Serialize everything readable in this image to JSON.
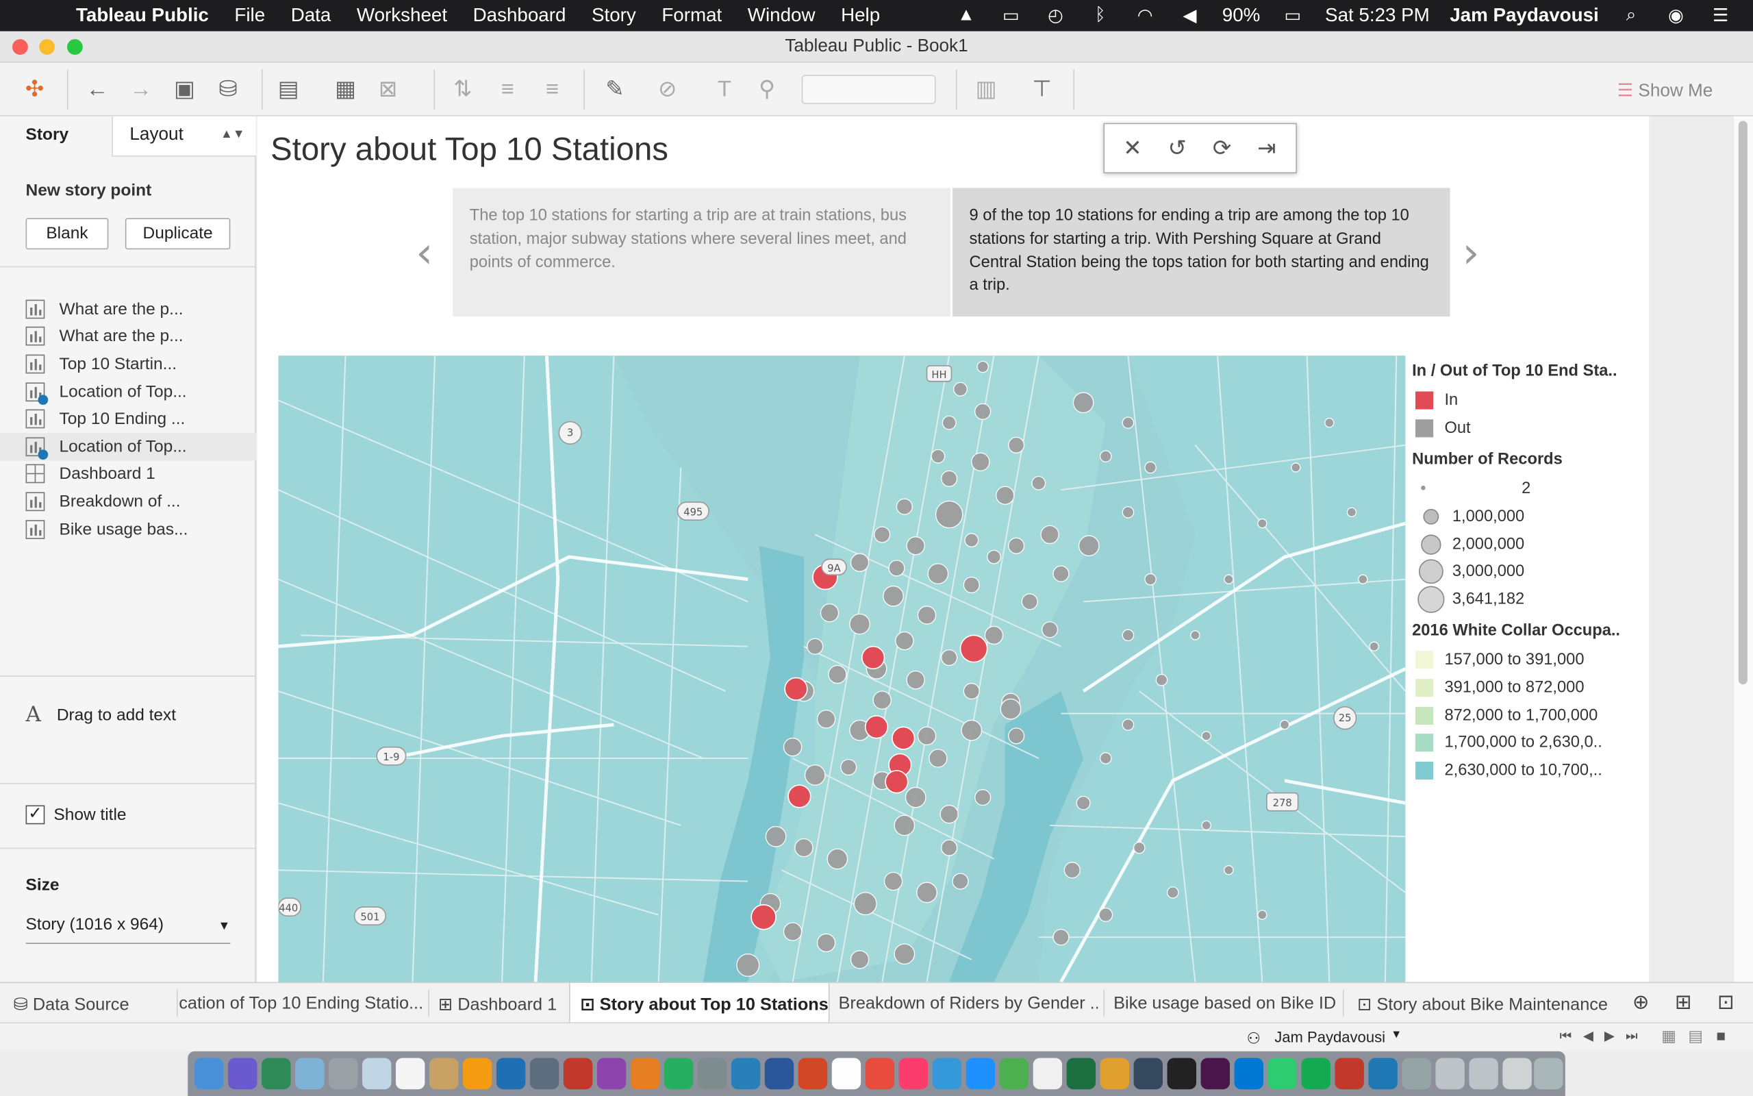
{
  "menubar": {
    "app_name": "Tableau Public",
    "items": [
      "File",
      "Data",
      "Worksheet",
      "Dashboard",
      "Story",
      "Format",
      "Window",
      "Help"
    ],
    "battery": "90%",
    "clock": "Sat 5:23 PM",
    "user": "Jam Paydavousi"
  },
  "window": {
    "title": "Tableau Public - Book1"
  },
  "toolbar": {
    "show_me": "Show Me"
  },
  "left_pane": {
    "tab_story": "Story",
    "tab_layout": "Layout",
    "new_story_point": "New story point",
    "blank_button": "Blank",
    "duplicate_button": "Duplicate",
    "story_items": [
      {
        "label": "What are the p...",
        "icon": "worksheet-icon"
      },
      {
        "label": "What are the p...",
        "icon": "worksheet-icon"
      },
      {
        "label": "Top 10 Startin...",
        "icon": "worksheet-icon"
      },
      {
        "label": "Location of Top...",
        "icon": "worksheet-check-icon"
      },
      {
        "label": "Top 10 Ending ...",
        "icon": "worksheet-icon"
      },
      {
        "label": "Location of Top...",
        "icon": "worksheet-check-icon"
      },
      {
        "label": "Dashboard 1",
        "icon": "dashboard-icon"
      },
      {
        "label": "Breakdown of ...",
        "icon": "worksheet-icon"
      },
      {
        "label": "Bike usage bas...",
        "icon": "worksheet-icon"
      }
    ],
    "drag_text": "Drag to add text",
    "show_title": "Show title",
    "size_heading": "Size",
    "size_value": "Story (1016 x 964)"
  },
  "story": {
    "title": "Story about Top 10 Stations",
    "points": [
      "The top 10 stations for starting a trip are at train stations, bus station, major subway stations where several lines meet, and points of commerce.",
      "9 of the top 10 stations for ending a trip are among the top 10 stations for starting a trip.  With Pershing Square at Grand Central Station being the tops tation for both starting and ending a trip."
    ]
  },
  "map": {
    "road_labels": [
      "3",
      "495",
      "1-9",
      "501",
      "440",
      "25",
      "278",
      "HH",
      "9A"
    ]
  },
  "legend": {
    "inout_title": "In / Out of Top 10 End Sta..",
    "inout_items": [
      {
        "label": "In",
        "color": "#e04b55"
      },
      {
        "label": "Out",
        "color": "#9e9e9e"
      }
    ],
    "records_title": "Number of Records",
    "records_items": [
      "2",
      "1,000,000",
      "2,000,000",
      "3,000,000",
      "3,641,182"
    ],
    "occupation_title": "2016 White Collar Occupa..",
    "occupation_items": [
      {
        "label": "157,000 to 391,000",
        "color": "#f2f7d8"
      },
      {
        "label": "391,000 to 872,000",
        "color": "#e1efc4"
      },
      {
        "label": "872,000 to 1,700,000",
        "color": "#c6e6bb"
      },
      {
        "label": "1,700,000 to 2,630,0..",
        "color": "#a6dcc4"
      },
      {
        "label": "2,630,000 to 10,700,..",
        "color": "#80cbcf"
      }
    ]
  },
  "sheet_tabs": {
    "data_source": "Data Source",
    "tabs": [
      "cation of Top 10 Ending Statio...",
      "Dashboard 1",
      "Story about Top 10 Stations",
      "Breakdown of Riders by Gender ...",
      "Bike usage based on Bike ID",
      "Story  about Bike Maintenance"
    ]
  },
  "status": {
    "user": "Jam Paydavousi"
  }
}
